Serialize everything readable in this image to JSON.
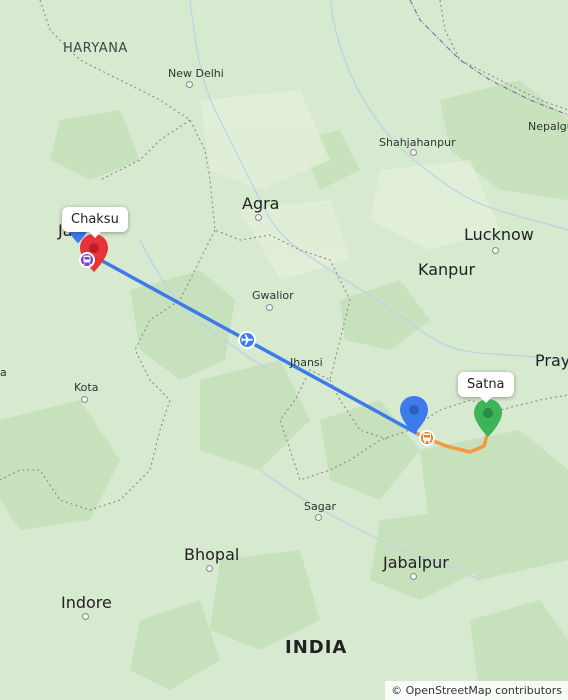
{
  "map": {
    "labels": {
      "haryana": "HARYANA",
      "new_delhi": "New Delhi",
      "shahjahanpur": "Shahjahanpur",
      "nepalgunj": "Nepalgu",
      "agra": "Agra",
      "lucknow": "Lucknow",
      "jaipur": "Jai",
      "kanpur": "Kanpur",
      "gwalior": "Gwalior",
      "jhansi": "Jhansi",
      "prayagraj": "Pray",
      "kota": "Kota",
      "west_edge": "a",
      "sagar": "Sagar",
      "bhopal": "Bhopal",
      "jabalpur": "Jabalpur",
      "indore": "Indore",
      "india": "INDIA"
    },
    "callouts": {
      "origin": "Chaksu",
      "destination": "Satna"
    },
    "colors": {
      "flight_route": "#3d7bea",
      "ground_route": "#f39a3c",
      "origin_pin": "#e8333a",
      "destination_pin": "#3db35a",
      "transit_pin": "#3d7bea",
      "start_pin": "#3d7bea",
      "train_icon": "#7a3fd0",
      "bus_icon": "#f07a1e"
    },
    "icons": [
      "airplane-icon",
      "train-icon",
      "bus-icon"
    ]
  },
  "attribution": "© OpenStreetMap contributors"
}
